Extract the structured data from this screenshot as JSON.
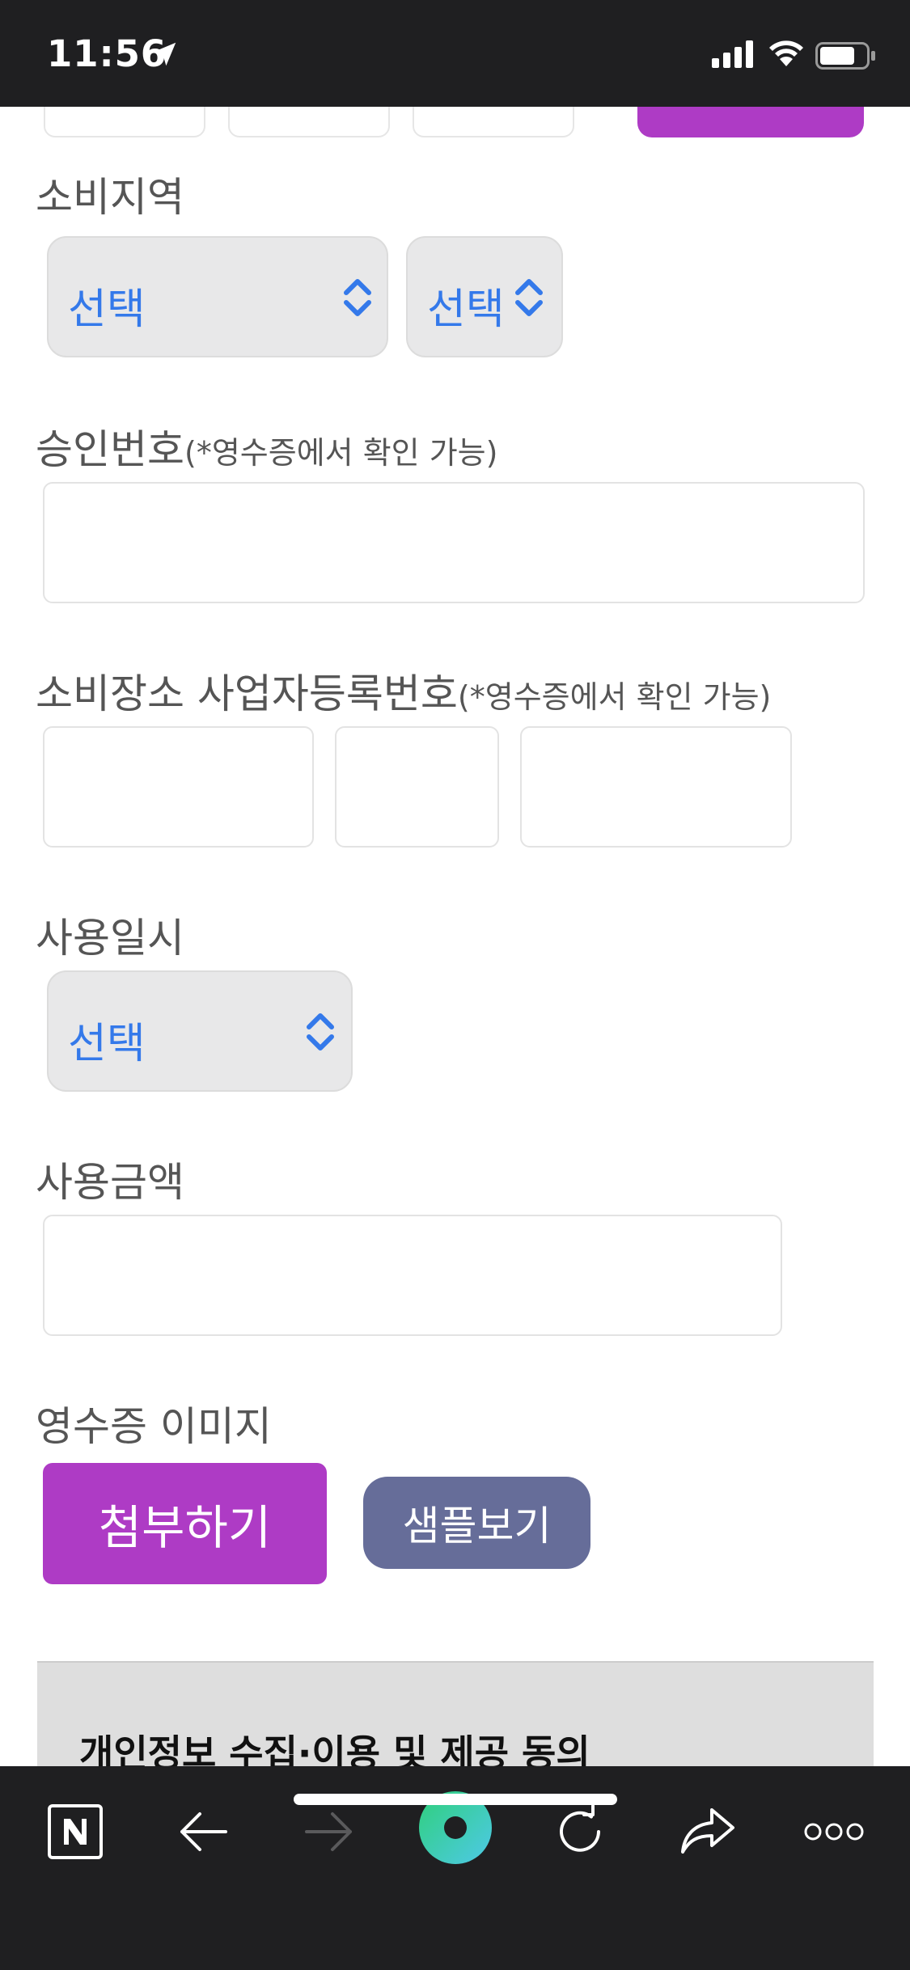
{
  "status_bar": {
    "time": "11:56"
  },
  "form": {
    "region": {
      "label": "소비지역",
      "select1": "선택",
      "select2": "선택"
    },
    "approval": {
      "label": "승인번호",
      "note": "(*영수증에서 확인 가능)",
      "value": ""
    },
    "business_reg": {
      "label": "소비장소 사업자등록번호",
      "note": "(*영수증에서 확인 가능)",
      "part1": "",
      "part2": "",
      "part3": ""
    },
    "usage_date": {
      "label": "사용일시",
      "select": "선택"
    },
    "amount": {
      "label": "사용금액",
      "value": ""
    },
    "receipt_image": {
      "label": "영수증 이미지",
      "attach_label": "첨부하기",
      "sample_label": "샘플보기"
    }
  },
  "consent": {
    "title": "개인정보 수집·이용 및 제공 동의"
  },
  "colors": {
    "accent_purple": "#ae3bc5",
    "sample_button": "#666d99",
    "select_text": "#3479ea",
    "bar_background": "#1f1f21"
  },
  "toolbar": {
    "icons": [
      "naver-n-icon",
      "back-arrow-icon",
      "forward-arrow-icon",
      "green-dot-icon",
      "refresh-icon",
      "share-icon",
      "more-icon"
    ]
  }
}
